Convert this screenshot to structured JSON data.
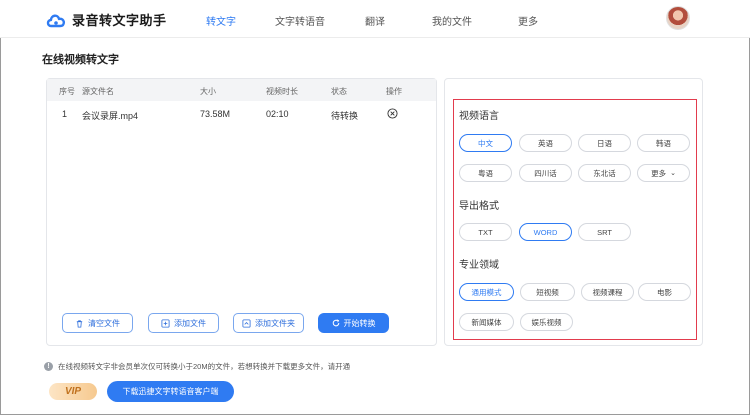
{
  "header": {
    "app_name": "录音转文字助手",
    "nav": [
      "转文字",
      "文字转语音",
      "翻译",
      "我的文件",
      "更多"
    ],
    "active_nav": "转文字"
  },
  "page_title": "在线视频转文字",
  "file_table": {
    "columns": [
      "序号",
      "源文件名",
      "大小",
      "视频时长",
      "状态",
      "操作"
    ],
    "rows": [
      {
        "index": "1",
        "name": "会议录屏.mp4",
        "size": "73.58M",
        "duration": "02:10",
        "status": "待转换"
      }
    ]
  },
  "actions": {
    "clear": "清空文件",
    "add_file": "添加文件",
    "add_folder": "添加文件夹",
    "start": "开始转换"
  },
  "settings": {
    "language": {
      "title": "视频语言",
      "options": [
        "中文",
        "英语",
        "日语",
        "韩语",
        "粤语",
        "四川话",
        "东北话",
        "更多"
      ],
      "selected": "中文"
    },
    "format": {
      "title": "导出格式",
      "options": [
        "TXT",
        "WORD",
        "SRT"
      ],
      "selected": "WORD"
    },
    "domain": {
      "title": "专业领域",
      "options": [
        "通用模式",
        "短视频",
        "视频课程",
        "电影",
        "新闻媒体",
        "娱乐视频"
      ],
      "selected": "通用模式"
    }
  },
  "footer": {
    "notice": "在线视频转文字非会员单次仅可转换小于20M的文件，若想转换并下载更多文件，请开通",
    "vip": "VIP",
    "download": "下载迅捷文字转语音客户端"
  },
  "colors": {
    "accent": "#2f7bf2",
    "highlight_border": "#e23b4d"
  }
}
